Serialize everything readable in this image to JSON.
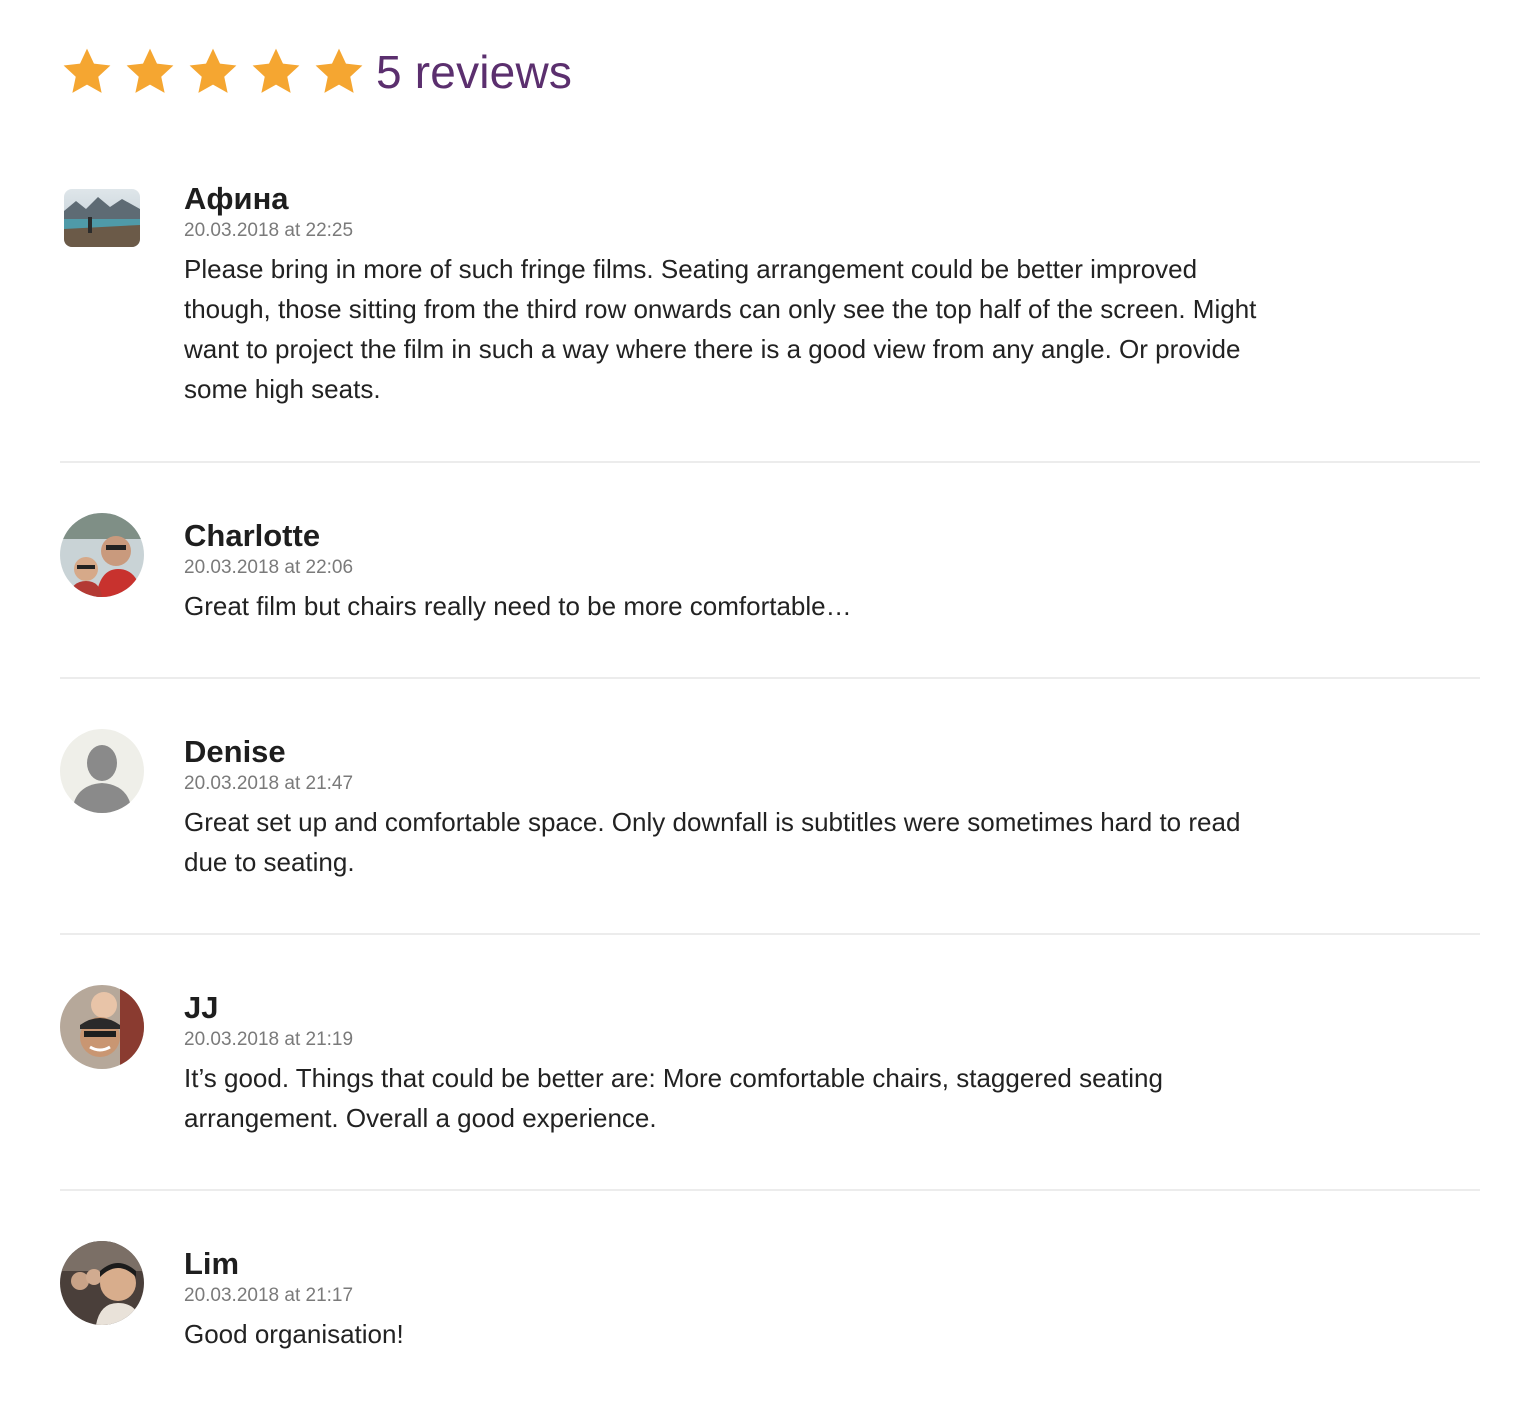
{
  "rating": {
    "stars": 5,
    "max_stars": 5,
    "star_color": "#f5a631",
    "count_label": "5 reviews",
    "count_color": "#5b2f6e"
  },
  "reviews": [
    {
      "name": "Афина",
      "date": "20.03.2018 at 22:25",
      "text": "Please bring in more of such fringe films. Seating arrangement could be better improved though, those sitting from the third row onwards can only see the top half of the screen. Might want to project the film in such a way where there is a good view from any angle. Or provide some high seats.",
      "avatar": "landscape-photo"
    },
    {
      "name": "Charlotte",
      "date": "20.03.2018 at 22:06",
      "text": "Great film but chairs really need to be more comfortable…",
      "avatar": "couple-selfie-photo"
    },
    {
      "name": "Denise",
      "date": "20.03.2018 at 21:47",
      "text": "Great set up and comfortable space. Only downfall is subtitles were sometimes hard to read due to seating.",
      "avatar": "default-user-silhouette"
    },
    {
      "name": "JJ",
      "date": "20.03.2018 at 21:19",
      "text": "It’s good. Things that could be better are: More comfortable chairs, staggered seating arrangement. Overall a good experience.",
      "avatar": "father-baby-photo"
    },
    {
      "name": "Lim",
      "date": "20.03.2018 at 21:17",
      "text": "Good organisation!",
      "avatar": "group-selfie-photo"
    }
  ]
}
